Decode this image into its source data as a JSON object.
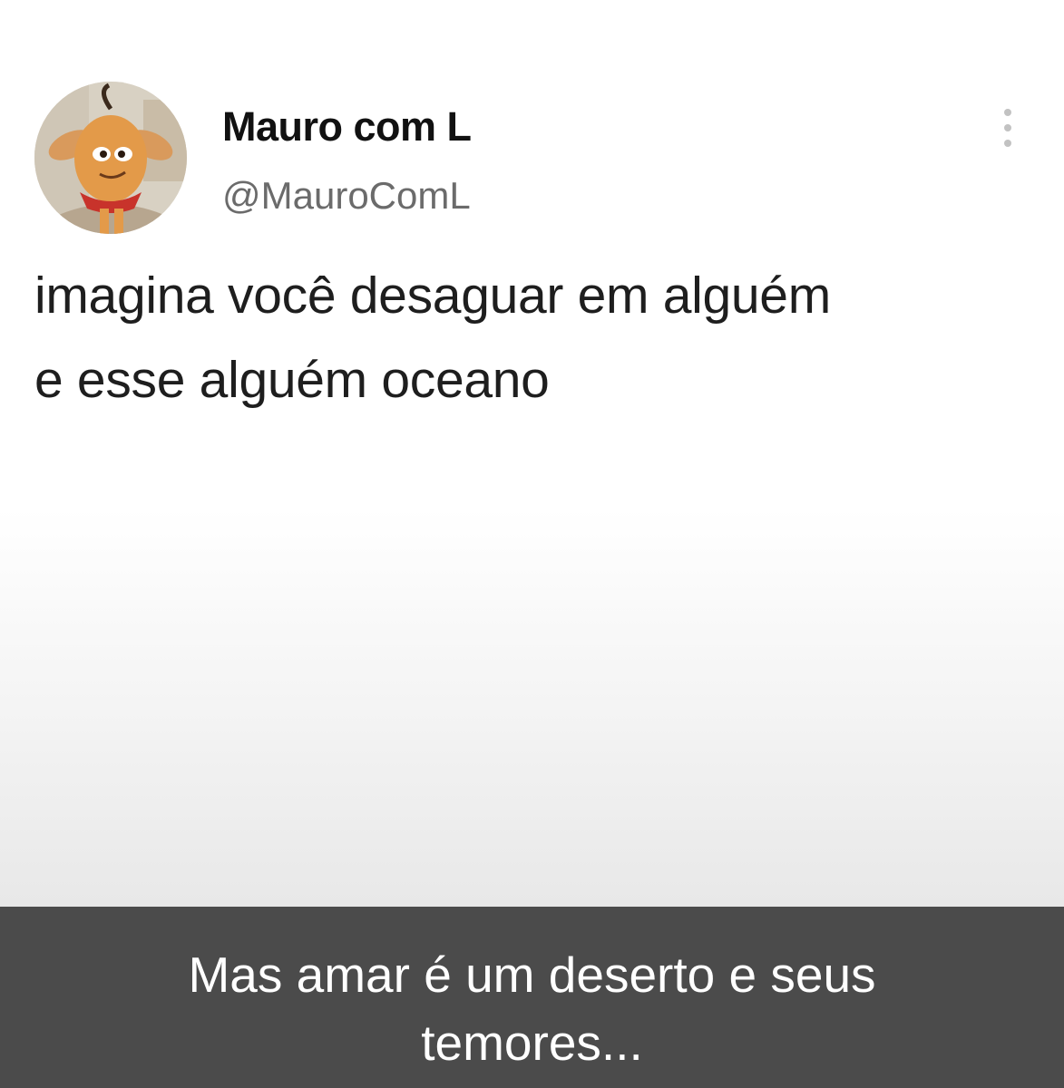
{
  "tweet": {
    "display_name": "Mauro com L",
    "handle": "@MauroComL",
    "text_lines": [
      "imagina você desaguar em alguém",
      "e esse alguém oceano"
    ]
  },
  "icons": {
    "avatar": "cartoon-character-avatar",
    "menu": "vertical-ellipsis-icon"
  },
  "overlay_caption": {
    "lines": [
      "Mas amar é um deserto e seus",
      "temores..."
    ]
  },
  "colors": {
    "caption_background": "#4b4b4b",
    "caption_text": "#ffffff",
    "display_name": "#111111",
    "handle": "#6b6b6b"
  }
}
